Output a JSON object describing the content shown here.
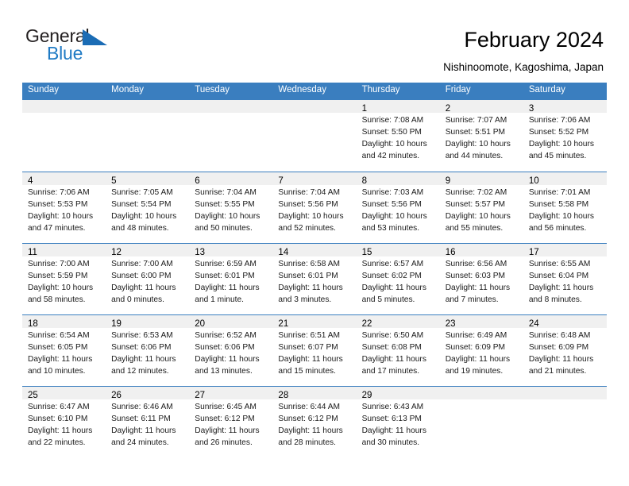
{
  "brand": {
    "name_part1": "General",
    "name_part2": "Blue",
    "triangle_color": "#1b6cb5",
    "blue_text_color": "#1f7ac4"
  },
  "header": {
    "title": "February 2024",
    "subtitle": "Nishinoomote, Kagoshima, Japan"
  },
  "theme": {
    "header_blue": "#3a7ebf",
    "day_band_gray": "#f0f0f0",
    "separator_blue": "#3a7ebf"
  },
  "weekdays": [
    "Sunday",
    "Monday",
    "Tuesday",
    "Wednesday",
    "Thursday",
    "Friday",
    "Saturday"
  ],
  "weeks": [
    [
      {
        "day": "",
        "sunrise": "",
        "sunset": "",
        "daylight_line1": "",
        "daylight_line2": "",
        "empty": true
      },
      {
        "day": "",
        "sunrise": "",
        "sunset": "",
        "daylight_line1": "",
        "daylight_line2": "",
        "empty": true
      },
      {
        "day": "",
        "sunrise": "",
        "sunset": "",
        "daylight_line1": "",
        "daylight_line2": "",
        "empty": true
      },
      {
        "day": "",
        "sunrise": "",
        "sunset": "",
        "daylight_line1": "",
        "daylight_line2": "",
        "empty": true
      },
      {
        "day": "1",
        "sunrise": "Sunrise: 7:08 AM",
        "sunset": "Sunset: 5:50 PM",
        "daylight_line1": "Daylight: 10 hours",
        "daylight_line2": "and 42 minutes.",
        "empty": false
      },
      {
        "day": "2",
        "sunrise": "Sunrise: 7:07 AM",
        "sunset": "Sunset: 5:51 PM",
        "daylight_line1": "Daylight: 10 hours",
        "daylight_line2": "and 44 minutes.",
        "empty": false
      },
      {
        "day": "3",
        "sunrise": "Sunrise: 7:06 AM",
        "sunset": "Sunset: 5:52 PM",
        "daylight_line1": "Daylight: 10 hours",
        "daylight_line2": "and 45 minutes.",
        "empty": false
      }
    ],
    [
      {
        "day": "4",
        "sunrise": "Sunrise: 7:06 AM",
        "sunset": "Sunset: 5:53 PM",
        "daylight_line1": "Daylight: 10 hours",
        "daylight_line2": "and 47 minutes.",
        "empty": false
      },
      {
        "day": "5",
        "sunrise": "Sunrise: 7:05 AM",
        "sunset": "Sunset: 5:54 PM",
        "daylight_line1": "Daylight: 10 hours",
        "daylight_line2": "and 48 minutes.",
        "empty": false
      },
      {
        "day": "6",
        "sunrise": "Sunrise: 7:04 AM",
        "sunset": "Sunset: 5:55 PM",
        "daylight_line1": "Daylight: 10 hours",
        "daylight_line2": "and 50 minutes.",
        "empty": false
      },
      {
        "day": "7",
        "sunrise": "Sunrise: 7:04 AM",
        "sunset": "Sunset: 5:56 PM",
        "daylight_line1": "Daylight: 10 hours",
        "daylight_line2": "and 52 minutes.",
        "empty": false
      },
      {
        "day": "8",
        "sunrise": "Sunrise: 7:03 AM",
        "sunset": "Sunset: 5:56 PM",
        "daylight_line1": "Daylight: 10 hours",
        "daylight_line2": "and 53 minutes.",
        "empty": false
      },
      {
        "day": "9",
        "sunrise": "Sunrise: 7:02 AM",
        "sunset": "Sunset: 5:57 PM",
        "daylight_line1": "Daylight: 10 hours",
        "daylight_line2": "and 55 minutes.",
        "empty": false
      },
      {
        "day": "10",
        "sunrise": "Sunrise: 7:01 AM",
        "sunset": "Sunset: 5:58 PM",
        "daylight_line1": "Daylight: 10 hours",
        "daylight_line2": "and 56 minutes.",
        "empty": false
      }
    ],
    [
      {
        "day": "11",
        "sunrise": "Sunrise: 7:00 AM",
        "sunset": "Sunset: 5:59 PM",
        "daylight_line1": "Daylight: 10 hours",
        "daylight_line2": "and 58 minutes.",
        "empty": false
      },
      {
        "day": "12",
        "sunrise": "Sunrise: 7:00 AM",
        "sunset": "Sunset: 6:00 PM",
        "daylight_line1": "Daylight: 11 hours",
        "daylight_line2": "and 0 minutes.",
        "empty": false
      },
      {
        "day": "13",
        "sunrise": "Sunrise: 6:59 AM",
        "sunset": "Sunset: 6:01 PM",
        "daylight_line1": "Daylight: 11 hours",
        "daylight_line2": "and 1 minute.",
        "empty": false
      },
      {
        "day": "14",
        "sunrise": "Sunrise: 6:58 AM",
        "sunset": "Sunset: 6:01 PM",
        "daylight_line1": "Daylight: 11 hours",
        "daylight_line2": "and 3 minutes.",
        "empty": false
      },
      {
        "day": "15",
        "sunrise": "Sunrise: 6:57 AM",
        "sunset": "Sunset: 6:02 PM",
        "daylight_line1": "Daylight: 11 hours",
        "daylight_line2": "and 5 minutes.",
        "empty": false
      },
      {
        "day": "16",
        "sunrise": "Sunrise: 6:56 AM",
        "sunset": "Sunset: 6:03 PM",
        "daylight_line1": "Daylight: 11 hours",
        "daylight_line2": "and 7 minutes.",
        "empty": false
      },
      {
        "day": "17",
        "sunrise": "Sunrise: 6:55 AM",
        "sunset": "Sunset: 6:04 PM",
        "daylight_line1": "Daylight: 11 hours",
        "daylight_line2": "and 8 minutes.",
        "empty": false
      }
    ],
    [
      {
        "day": "18",
        "sunrise": "Sunrise: 6:54 AM",
        "sunset": "Sunset: 6:05 PM",
        "daylight_line1": "Daylight: 11 hours",
        "daylight_line2": "and 10 minutes.",
        "empty": false
      },
      {
        "day": "19",
        "sunrise": "Sunrise: 6:53 AM",
        "sunset": "Sunset: 6:06 PM",
        "daylight_line1": "Daylight: 11 hours",
        "daylight_line2": "and 12 minutes.",
        "empty": false
      },
      {
        "day": "20",
        "sunrise": "Sunrise: 6:52 AM",
        "sunset": "Sunset: 6:06 PM",
        "daylight_line1": "Daylight: 11 hours",
        "daylight_line2": "and 13 minutes.",
        "empty": false
      },
      {
        "day": "21",
        "sunrise": "Sunrise: 6:51 AM",
        "sunset": "Sunset: 6:07 PM",
        "daylight_line1": "Daylight: 11 hours",
        "daylight_line2": "and 15 minutes.",
        "empty": false
      },
      {
        "day": "22",
        "sunrise": "Sunrise: 6:50 AM",
        "sunset": "Sunset: 6:08 PM",
        "daylight_line1": "Daylight: 11 hours",
        "daylight_line2": "and 17 minutes.",
        "empty": false
      },
      {
        "day": "23",
        "sunrise": "Sunrise: 6:49 AM",
        "sunset": "Sunset: 6:09 PM",
        "daylight_line1": "Daylight: 11 hours",
        "daylight_line2": "and 19 minutes.",
        "empty": false
      },
      {
        "day": "24",
        "sunrise": "Sunrise: 6:48 AM",
        "sunset": "Sunset: 6:09 PM",
        "daylight_line1": "Daylight: 11 hours",
        "daylight_line2": "and 21 minutes.",
        "empty": false
      }
    ],
    [
      {
        "day": "25",
        "sunrise": "Sunrise: 6:47 AM",
        "sunset": "Sunset: 6:10 PM",
        "daylight_line1": "Daylight: 11 hours",
        "daylight_line2": "and 22 minutes.",
        "empty": false
      },
      {
        "day": "26",
        "sunrise": "Sunrise: 6:46 AM",
        "sunset": "Sunset: 6:11 PM",
        "daylight_line1": "Daylight: 11 hours",
        "daylight_line2": "and 24 minutes.",
        "empty": false
      },
      {
        "day": "27",
        "sunrise": "Sunrise: 6:45 AM",
        "sunset": "Sunset: 6:12 PM",
        "daylight_line1": "Daylight: 11 hours",
        "daylight_line2": "and 26 minutes.",
        "empty": false
      },
      {
        "day": "28",
        "sunrise": "Sunrise: 6:44 AM",
        "sunset": "Sunset: 6:12 PM",
        "daylight_line1": "Daylight: 11 hours",
        "daylight_line2": "and 28 minutes.",
        "empty": false
      },
      {
        "day": "29",
        "sunrise": "Sunrise: 6:43 AM",
        "sunset": "Sunset: 6:13 PM",
        "daylight_line1": "Daylight: 11 hours",
        "daylight_line2": "and 30 minutes.",
        "empty": false
      },
      {
        "day": "",
        "sunrise": "",
        "sunset": "",
        "daylight_line1": "",
        "daylight_line2": "",
        "empty": true
      },
      {
        "day": "",
        "sunrise": "",
        "sunset": "",
        "daylight_line1": "",
        "daylight_line2": "",
        "empty": true
      }
    ]
  ]
}
